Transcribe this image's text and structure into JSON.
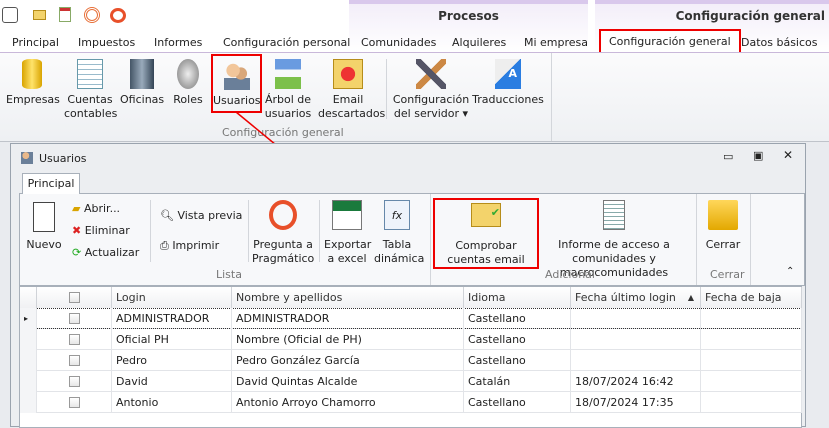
{
  "quick_access": {
    "icons": [
      "app-icon",
      "mail-icon",
      "clipboard-check-icon",
      "signal-icon",
      "robot-icon"
    ]
  },
  "context_groups": [
    {
      "label": "Procesos"
    },
    {
      "label": "Configuración general"
    }
  ],
  "tabs": [
    "Principal",
    "Impuestos",
    "Informes",
    "Configuración personal",
    "Comunidades",
    "Alquileres",
    "Mi empresa",
    "Configuración general",
    "Datos básicos"
  ],
  "selected_tab": "Configuración general",
  "ribbon": {
    "buttons": [
      "Empresas",
      "Cuentas contables",
      "Oficinas",
      "Roles",
      "Usuarios",
      "Árbol de usuarios",
      "Email descartados",
      "Configuración del servidor ▾",
      "Traducciones"
    ],
    "group_label": "Configuración general"
  },
  "window": {
    "title": "Usuarios",
    "tab": "Principal",
    "buttons": {
      "nuevo": "Nuevo",
      "abrir": "Abrir...",
      "eliminar": "Eliminar",
      "actualizar": "Actualizar",
      "vista_previa": "Vista previa",
      "imprimir": "Imprimir",
      "pregunta": "Pregunta a Pragmático",
      "exportar": "Exportar a excel",
      "tabla": "Tabla dinámica",
      "comprobar": "Comprobar cuentas email",
      "informe": "Informe de acceso a comunidades y macrocomunidades",
      "cerrar": "Cerrar"
    },
    "groups": {
      "lista": "Lista",
      "adicional": "Adicional",
      "cerrar": "Cerrar"
    }
  },
  "grid": {
    "columns": [
      "Login",
      "Nombre y apellidos",
      "Idioma",
      "Fecha último login",
      "Fecha de baja"
    ],
    "sort_column": "Fecha último login",
    "rows": [
      [
        "ADMINISTRADOR",
        "ADMINISTRADOR",
        "Castellano",
        "",
        ""
      ],
      [
        "Oficial PH",
        "Nombre (Oficial de PH)",
        "Castellano",
        "",
        ""
      ],
      [
        "Pedro",
        "Pedro González García",
        "Castellano",
        "",
        ""
      ],
      [
        "David",
        "David Quintas Alcalde",
        "Catalán",
        "18/07/2024 16:42",
        ""
      ],
      [
        "Antonio",
        "Antonio Arroyo Chamorro",
        "Castellano",
        "18/07/2024 17:35",
        ""
      ]
    ]
  },
  "colors": {
    "highlight": "#e00000",
    "context_tab": "#d9c8ec"
  }
}
